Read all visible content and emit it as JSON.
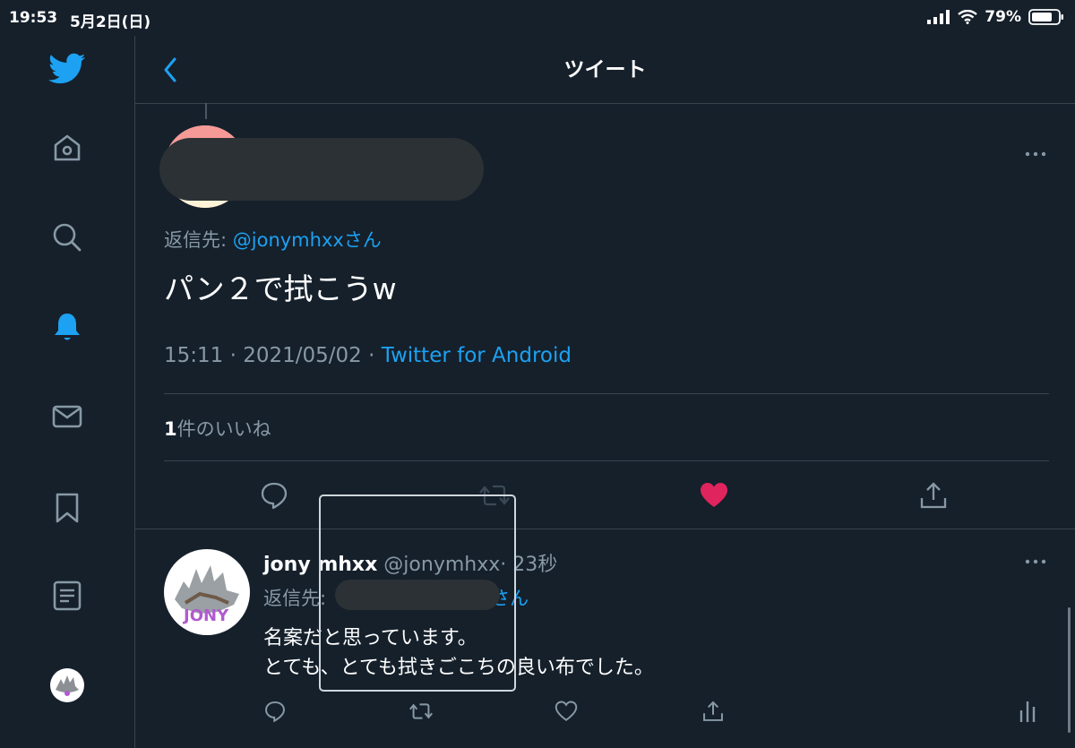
{
  "status_bar": {
    "time": "19:53",
    "date": "5月2日(日)",
    "battery": "79%"
  },
  "header": {
    "title": "ツイート"
  },
  "tweet": {
    "reply_prefix": "返信先: ",
    "reply_handle": "@jonymhxxさん",
    "text": "パン２で拭こうw",
    "timestamp": "15:11 · 2021/05/02 · ",
    "source": "Twitter for Android",
    "likes_count": "1",
    "likes_label": "件のいいね"
  },
  "reply": {
    "name": "jony mhxx",
    "handle": "@jonymhxx",
    "time": "· 23秒",
    "reply_prefix": "返信先:",
    "reply_suffix": "さん",
    "line1": "名案だと思っています。",
    "line2": "とても、とても拭きごこちの良い布でした。",
    "avatar_text": "JONY"
  },
  "colors": {
    "background": "#15202b",
    "accent": "#1da1f2",
    "like": "#e0245e",
    "muted": "#8899a6",
    "border": "#38444d"
  },
  "icons": {
    "sidebar": [
      "twitter-logo-icon",
      "home-icon",
      "search-icon",
      "notifications-bell-icon",
      "messages-envelope-icon",
      "bookmarks-icon",
      "lists-icon",
      "profile-avatar"
    ],
    "tweet_actions": [
      "reply-icon",
      "retweet-icon",
      "like-heart-icon",
      "share-icon"
    ],
    "reply_actions": [
      "reply-icon",
      "retweet-icon",
      "like-heart-icon",
      "share-icon",
      "analytics-icon"
    ]
  }
}
